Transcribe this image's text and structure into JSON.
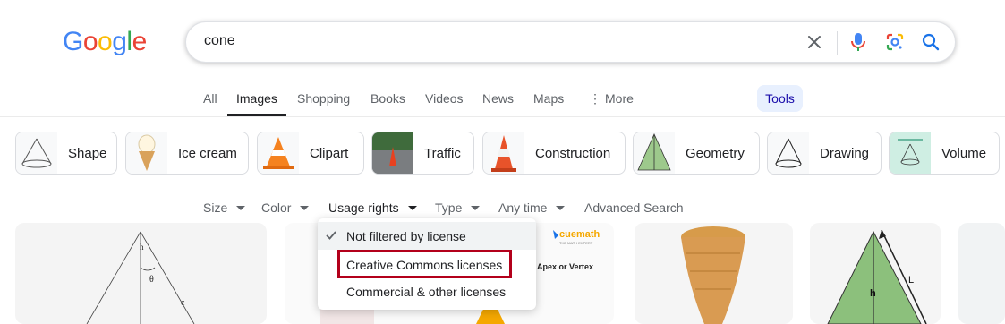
{
  "logo": {
    "letters": [
      "G",
      "o",
      "o",
      "g",
      "l",
      "e"
    ],
    "colors": [
      "#4285f4",
      "#ea4335",
      "#fbbc05",
      "#4285f4",
      "#34a853",
      "#ea4335"
    ]
  },
  "search": {
    "query": "cone",
    "clear_icon": "close-icon",
    "mic_icon": "mic-icon",
    "lens_icon": "lens-icon",
    "search_icon": "search-icon"
  },
  "tabs": [
    {
      "label": "All",
      "active": false
    },
    {
      "label": "Images",
      "active": true
    },
    {
      "label": "Shopping",
      "active": false
    },
    {
      "label": "Books",
      "active": false
    },
    {
      "label": "Videos",
      "active": false
    },
    {
      "label": "News",
      "active": false
    },
    {
      "label": "Maps",
      "active": false
    },
    {
      "label": "More",
      "active": false
    }
  ],
  "tools_label": "Tools",
  "chips": [
    {
      "label": "Shape"
    },
    {
      "label": "Ice cream"
    },
    {
      "label": "Clipart"
    },
    {
      "label": "Traffic"
    },
    {
      "label": "Construction"
    },
    {
      "label": "Geometry"
    },
    {
      "label": "Drawing"
    },
    {
      "label": "Volume"
    }
  ],
  "filters": [
    {
      "label": "Size"
    },
    {
      "label": "Color"
    },
    {
      "label": "Usage rights"
    },
    {
      "label": "Type"
    },
    {
      "label": "Any time"
    }
  ],
  "advanced_search_label": "Advanced Search",
  "usage_menu": {
    "items": [
      {
        "label": "Not filtered by license",
        "selected": true
      },
      {
        "label": "Creative Commons licenses",
        "selected": false
      },
      {
        "label": "Commercial & other licenses",
        "selected": false
      }
    ]
  },
  "results": {
    "cuemath_brand": "cuemath",
    "cuemath_tagline": "THE MATH EXPERT",
    "cuemath_caption": "Apex or Vertex",
    "diagram_labels": {
      "h": "h",
      "theta": "θ",
      "c": "c",
      "L": "L"
    }
  },
  "colors": {
    "accent": "#1a73e8",
    "highlight": "#b3001b",
    "tools_bg": "#e8f0fe"
  }
}
